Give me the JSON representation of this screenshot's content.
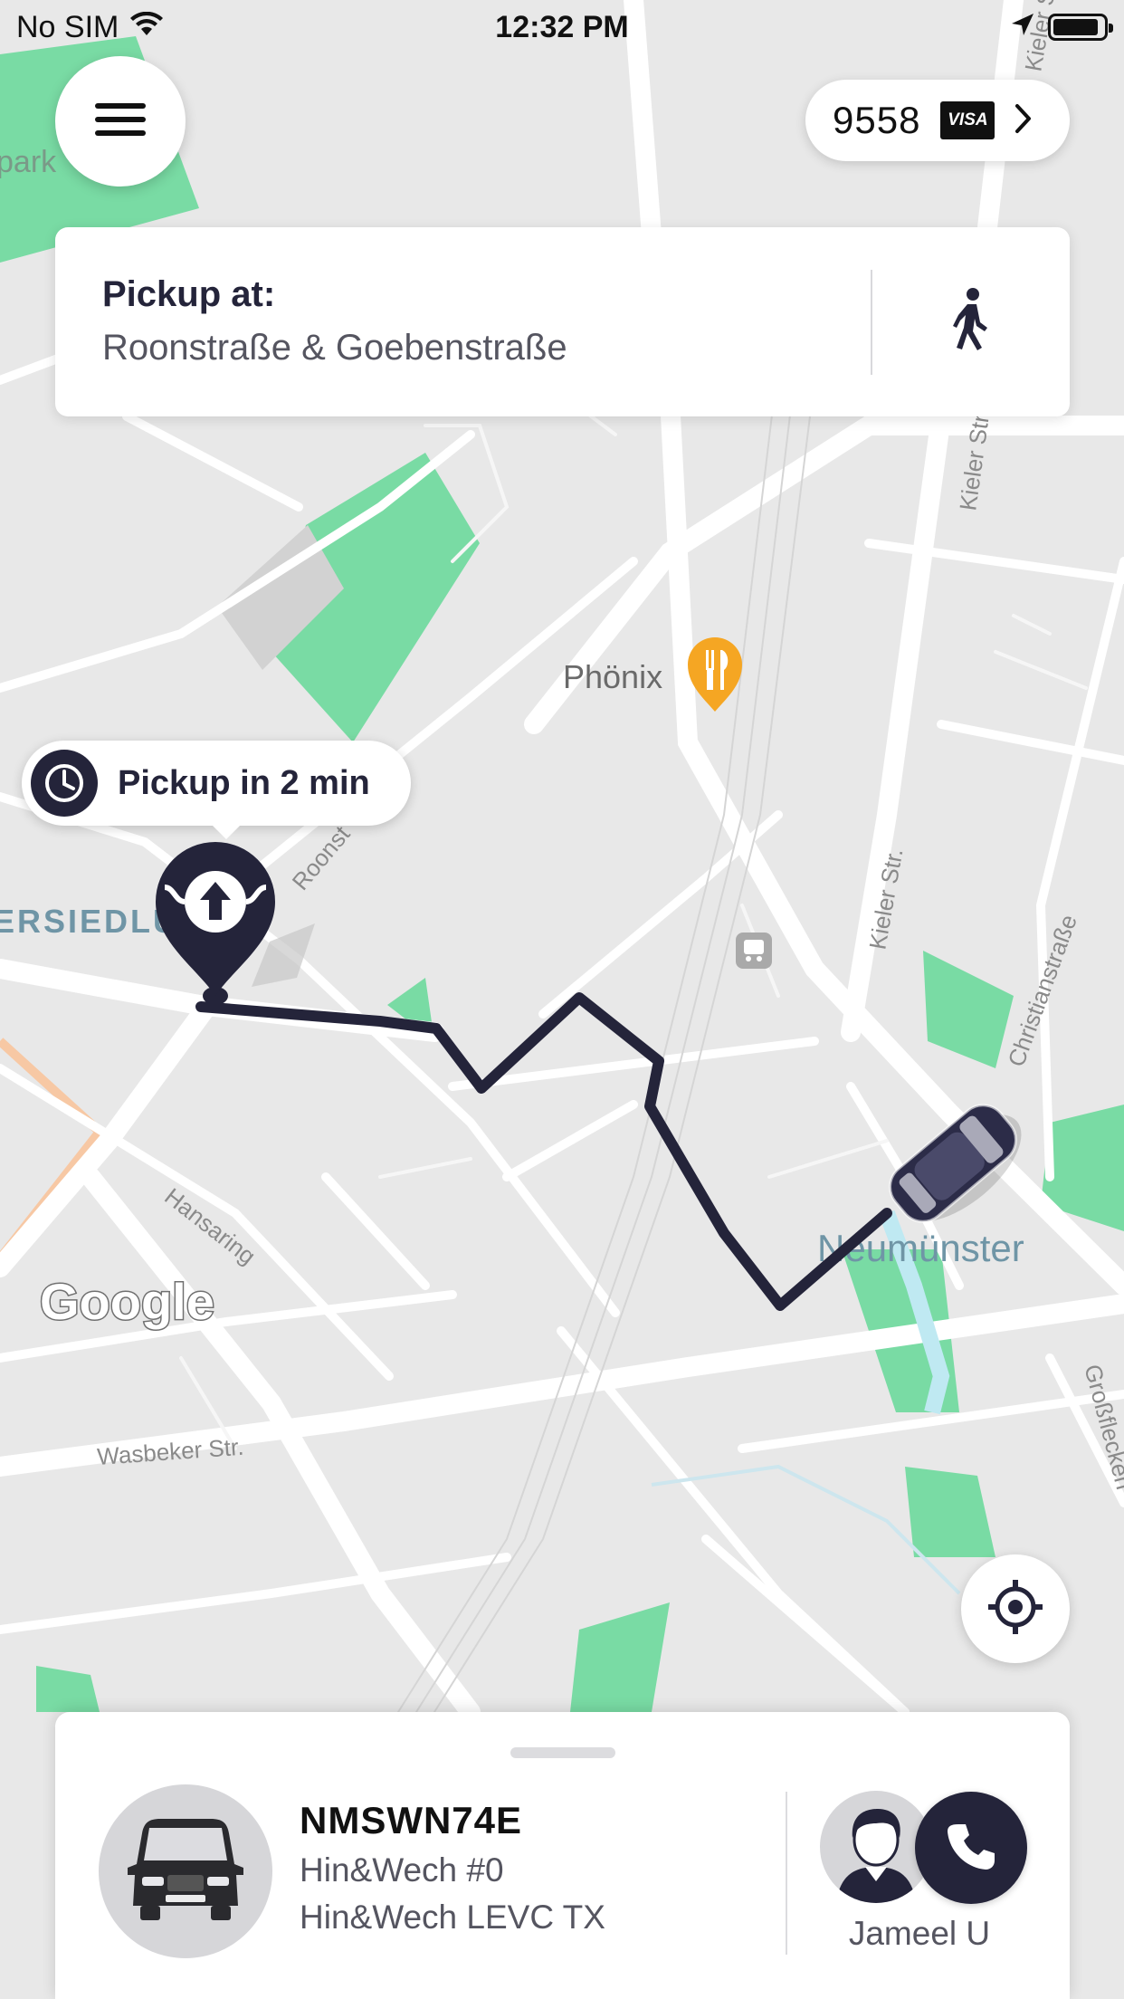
{
  "status_bar": {
    "carrier": "No SIM",
    "time": "12:32 PM",
    "battery_level": 0.9
  },
  "header": {
    "menu_icon": "hamburger-menu-icon",
    "payment_last_digits": "9558",
    "payment_brand": "VISA",
    "payment_chevron_icon": "chevron-right-icon"
  },
  "pickup": {
    "label": "Pickup at:",
    "address": "Roonstraße & Goebenstraße",
    "walk_icon": "walking-person-icon"
  },
  "map": {
    "eta_text": "Pickup in 2 min",
    "poi_name": "Phönix",
    "place_label": "Neumünster",
    "district_label": "ERSIEDLU",
    "streets": [
      "Kieler Str.",
      "Kieler Str.",
      "Kieler Str.",
      "Christianstraße",
      "Roonst",
      "Hansaring",
      "Wasbeker Str.",
      "Großflecken"
    ],
    "park_label": "park",
    "google_logo": "Google",
    "colors": {
      "route": "#24243a",
      "park": "#79dba4",
      "poi": "#f5a623",
      "road_major": "#f7c8a4"
    }
  },
  "controls": {
    "locate_icon": "crosshair-locate-icon"
  },
  "ride": {
    "plate": "NMSWN74E",
    "vehicle_name": "Hin&Wech #0",
    "vehicle_model": "Hin&Wech LEVC TX",
    "driver_name": "Jameel U",
    "call_icon": "phone-icon"
  }
}
